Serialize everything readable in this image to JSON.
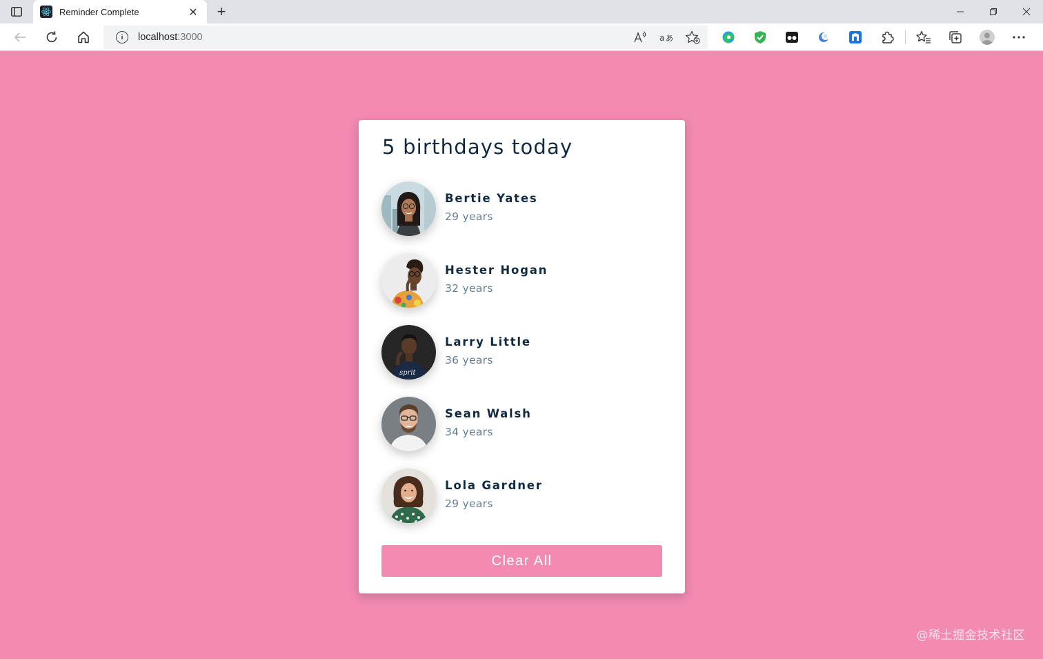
{
  "browser": {
    "tab_title": "Reminder Complete",
    "address_host": "localhost",
    "address_port": ":3000"
  },
  "card": {
    "title": "5 birthdays today",
    "people": [
      {
        "name": "Bertie Yates",
        "age": "29 years"
      },
      {
        "name": "Hester Hogan",
        "age": "32 years"
      },
      {
        "name": "Larry Little",
        "age": "36 years"
      },
      {
        "name": "Sean Walsh",
        "age": "34 years"
      },
      {
        "name": "Lola Gardner",
        "age": "29 years"
      }
    ],
    "clear_label": "Clear All"
  },
  "watermark": "@稀土掘金技术社区",
  "colors": {
    "page_background": "#f28ab2",
    "title_text": "#102a42",
    "secondary_text": "#617d98",
    "button_background": "#f28ab2"
  },
  "icons": {
    "tab_sidebar": "tab-actions-icon",
    "favicon": "react-icon",
    "back": "back-arrow-icon",
    "refresh": "refresh-icon",
    "home": "home-icon",
    "site_info": "info-icon",
    "read_aloud": "read-aloud-icon",
    "translate": "translate-icon",
    "add_favorite": "add-favorite-icon",
    "extensions": "puzzle-icon",
    "favorites": "favorites-icon",
    "collections": "collections-icon",
    "profile": "profile-icon",
    "more": "more-icon"
  }
}
